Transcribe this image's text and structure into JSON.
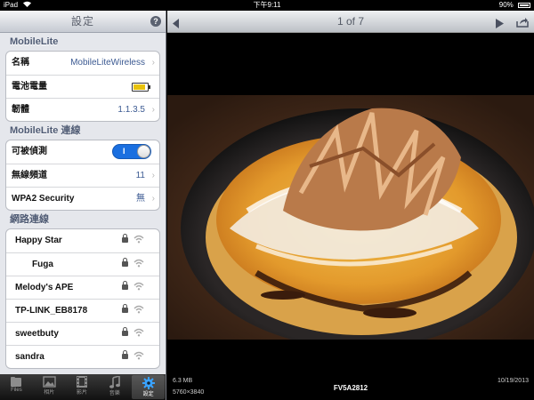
{
  "status_bar": {
    "device": "iPad",
    "time": "下午9:11",
    "battery": "90%",
    "battery_level": 0.9
  },
  "settings": {
    "title": "設定",
    "help_label": "?",
    "section1": {
      "header": "MobileLite",
      "name_label": "名稱",
      "name_value": "MobileLiteWireless",
      "battery_label": "電池電量",
      "battery_level": 0.85,
      "firmware_label": "韌體",
      "firmware_value": "1.1.3.5"
    },
    "section2": {
      "header": "MobileLite 連線",
      "discoverable_label": "可被偵測",
      "discoverable_on": "I",
      "channel_label": "無線頻道",
      "channel_value": "11",
      "security_label": "WPA2 Security",
      "security_value": "無"
    },
    "section3": {
      "header": "網路連線",
      "networks": [
        {
          "name": "Happy Star",
          "indent": false
        },
        {
          "name": "Fuga",
          "indent": true
        },
        {
          "name": "Melody's APE",
          "indent": false
        },
        {
          "name": "TP-LINK_EB8178",
          "indent": false
        },
        {
          "name": "sweetbuty",
          "indent": false
        },
        {
          "name": "sandra",
          "indent": false
        }
      ]
    }
  },
  "tabs": [
    {
      "label": "Files",
      "icon": "files-icon"
    },
    {
      "label": "相片",
      "icon": "photos-icon"
    },
    {
      "label": "影片",
      "icon": "videos-icon"
    },
    {
      "label": "音樂",
      "icon": "music-icon"
    },
    {
      "label": "設定",
      "icon": "settings-icon",
      "active": true
    }
  ],
  "viewer": {
    "title": "1 of 7",
    "file_size": "6.3 MB",
    "dimensions": "5760×3840",
    "filename": "FV5A2812",
    "date": "10/19/2013"
  },
  "colors": {
    "accent": "#1a6fe0",
    "value_text": "#3c5a92",
    "section_header": "#4f5b74"
  }
}
